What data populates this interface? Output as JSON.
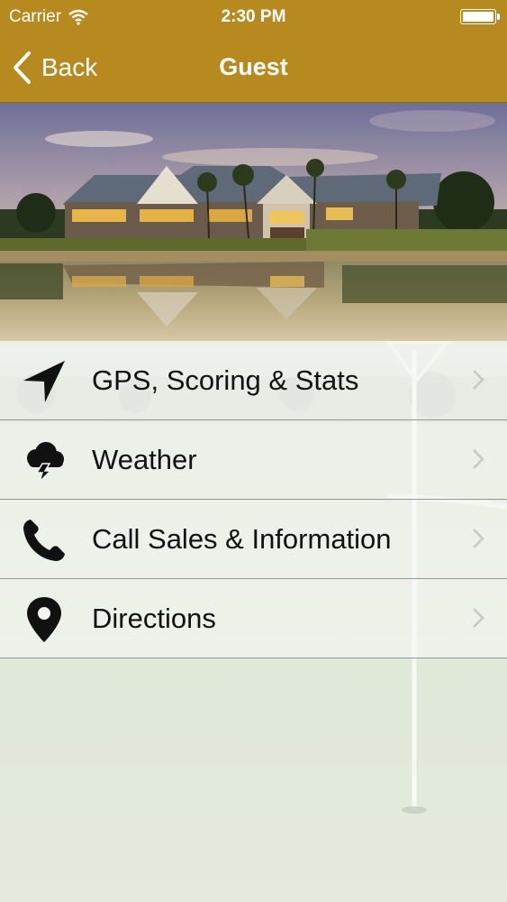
{
  "status_bar": {
    "carrier": "Carrier",
    "time": "2:30 PM",
    "battery_level": 1.0
  },
  "nav": {
    "back_label": "Back",
    "title": "Guest"
  },
  "menu": {
    "items": [
      {
        "label": "GPS, Scoring & Stats",
        "icon": "navigation-arrow-icon"
      },
      {
        "label": "Weather",
        "icon": "storm-cloud-icon"
      },
      {
        "label": "Call Sales & Information",
        "icon": "phone-icon"
      },
      {
        "label": "Directions",
        "icon": "map-pin-icon"
      }
    ]
  },
  "colors": {
    "nav_bar": "#b68a1f",
    "text": "#111111",
    "divider": "#8c9890"
  }
}
